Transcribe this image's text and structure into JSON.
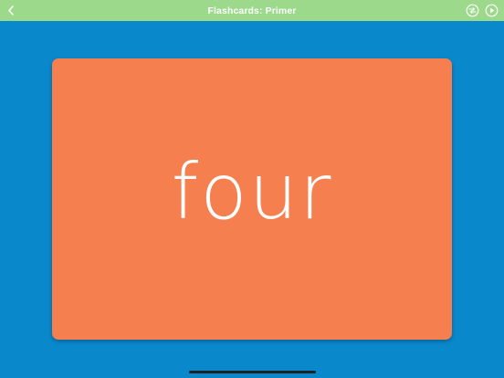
{
  "header": {
    "title": "Flashcards: Primer",
    "back_icon": "chevron-left-icon",
    "shuffle_icon": "shuffle-icon",
    "play_icon": "play-icon"
  },
  "card": {
    "word": "four"
  },
  "colors": {
    "background": "#0a88cc",
    "header": "#9cd98b",
    "card": "#f57f4e",
    "text": "#ffffff"
  }
}
